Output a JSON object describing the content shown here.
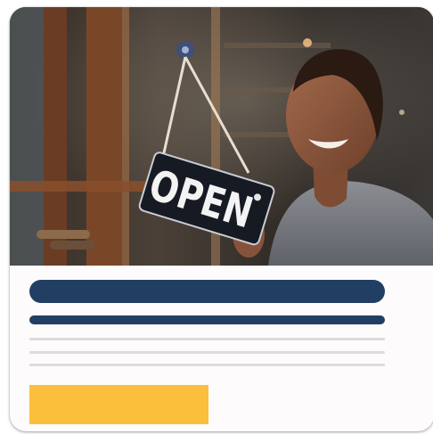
{
  "card": {
    "image": {
      "sign_text": "OPEN"
    },
    "colors": {
      "title_bar": "#213f62",
      "text_line": "#dcdcdc",
      "cta_button": "#fbbf3b",
      "card_background": "#fdfbfc"
    }
  }
}
